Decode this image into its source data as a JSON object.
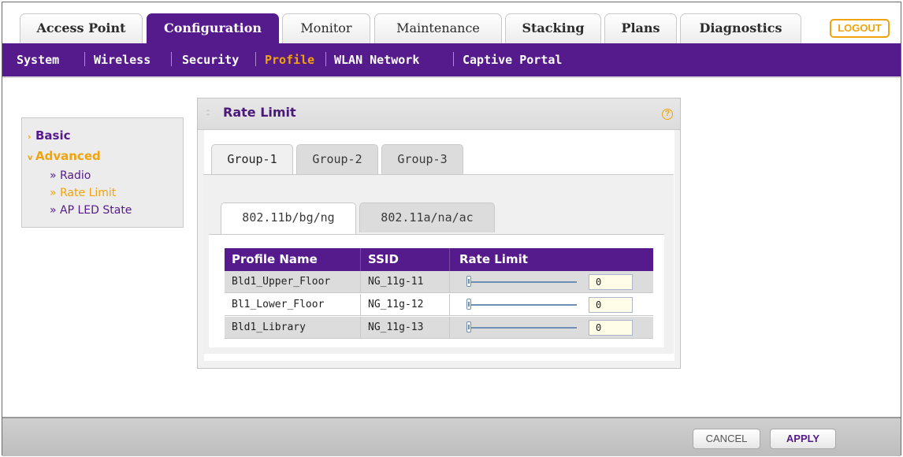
{
  "top_tabs": [
    {
      "label": "Access Point"
    },
    {
      "label": "Configuration"
    },
    {
      "label": "Monitor"
    },
    {
      "label": "Maintenance"
    },
    {
      "label": "Stacking"
    },
    {
      "label": "Plans"
    },
    {
      "label": "Diagnostics"
    }
  ],
  "logout_label": "LOGOUT",
  "subnav": [
    {
      "label": "System"
    },
    {
      "label": "Wireless"
    },
    {
      "label": "Security"
    },
    {
      "label": "Profile"
    },
    {
      "label": "WLAN Network"
    },
    {
      "label": "Captive Portal"
    }
  ],
  "left_menu": {
    "basic": "Basic",
    "advanced": "Advanced",
    "items": [
      {
        "label": "» Radio"
      },
      {
        "label": "» Rate Limit"
      },
      {
        "label": "» AP LED State"
      }
    ]
  },
  "panel": {
    "title": "Rate Limit",
    "help": "?",
    "group_tabs": [
      {
        "label": "Group-1"
      },
      {
        "label": "Group-2"
      },
      {
        "label": "Group-3"
      }
    ],
    "band_tabs": [
      {
        "label": "802.11b/bg/ng"
      },
      {
        "label": "802.11a/na/ac"
      }
    ],
    "table": {
      "headers": [
        "Profile Name",
        "SSID",
        "Rate Limit"
      ],
      "rows": [
        {
          "profile": "Bld1_Upper_Floor",
          "ssid": "NG_11g-11",
          "rate": "0",
          "slider_value": 0
        },
        {
          "profile": "Bl1_Lower_Floor",
          "ssid": "NG_11g-12",
          "rate": "0",
          "slider_value": 0
        },
        {
          "profile": "Bld1_Library",
          "ssid": "NG_11g-13",
          "rate": "0",
          "slider_value": 0
        }
      ]
    }
  },
  "footer": {
    "cancel": "CANCEL",
    "apply": "APPLY"
  },
  "colors": {
    "brand_purple": "#551a8b",
    "accent_orange": "#f0a30a"
  }
}
